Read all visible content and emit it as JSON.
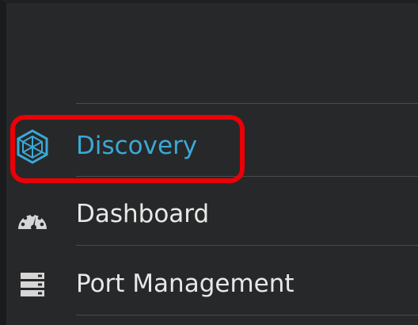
{
  "sidebar": {
    "items": [
      {
        "label": "Discovery",
        "icon": "discovery-hexagon-icon",
        "active": true
      },
      {
        "label": "Dashboard",
        "icon": "dashboard-gauge-icon",
        "active": false
      },
      {
        "label": "Port Management",
        "icon": "port-management-icon",
        "active": false
      }
    ]
  },
  "colors": {
    "background": "#272829",
    "active_text": "#3aa9d7",
    "text": "#e8e8e8",
    "highlight": "#ea0006",
    "divider": "#4a4b4d"
  }
}
